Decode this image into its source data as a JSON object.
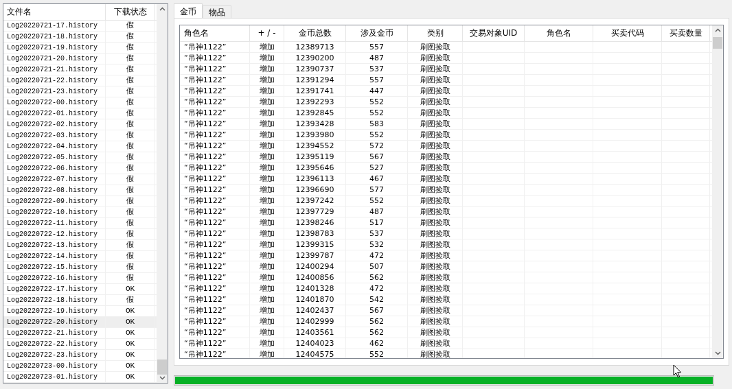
{
  "file_list": {
    "columns": [
      "文件名",
      "下载状态"
    ],
    "items": [
      {
        "name": "Log20220721-17.history",
        "status": "假",
        "selected": false
      },
      {
        "name": "Log20220721-18.history",
        "status": "假",
        "selected": false
      },
      {
        "name": "Log20220721-19.history",
        "status": "假",
        "selected": false
      },
      {
        "name": "Log20220721-20.history",
        "status": "假",
        "selected": false
      },
      {
        "name": "Log20220721-21.history",
        "status": "假",
        "selected": false
      },
      {
        "name": "Log20220721-22.history",
        "status": "假",
        "selected": false
      },
      {
        "name": "Log20220721-23.history",
        "status": "假",
        "selected": false
      },
      {
        "name": "Log20220722-00.history",
        "status": "假",
        "selected": false
      },
      {
        "name": "Log20220722-01.history",
        "status": "假",
        "selected": false
      },
      {
        "name": "Log20220722-02.history",
        "status": "假",
        "selected": false
      },
      {
        "name": "Log20220722-03.history",
        "status": "假",
        "selected": false
      },
      {
        "name": "Log20220722-04.history",
        "status": "假",
        "selected": false
      },
      {
        "name": "Log20220722-05.history",
        "status": "假",
        "selected": false
      },
      {
        "name": "Log20220722-06.history",
        "status": "假",
        "selected": false
      },
      {
        "name": "Log20220722-07.history",
        "status": "假",
        "selected": false
      },
      {
        "name": "Log20220722-08.history",
        "status": "假",
        "selected": false
      },
      {
        "name": "Log20220722-09.history",
        "status": "假",
        "selected": false
      },
      {
        "name": "Log20220722-10.history",
        "status": "假",
        "selected": false
      },
      {
        "name": "Log20220722-11.history",
        "status": "假",
        "selected": false
      },
      {
        "name": "Log20220722-12.history",
        "status": "假",
        "selected": false
      },
      {
        "name": "Log20220722-13.history",
        "status": "假",
        "selected": false
      },
      {
        "name": "Log20220722-14.history",
        "status": "假",
        "selected": false
      },
      {
        "name": "Log20220722-15.history",
        "status": "假",
        "selected": false
      },
      {
        "name": "Log20220722-16.history",
        "status": "假",
        "selected": false
      },
      {
        "name": "Log20220722-17.history",
        "status": "OK",
        "selected": false
      },
      {
        "name": "Log20220722-18.history",
        "status": "假",
        "selected": false
      },
      {
        "name": "Log20220722-19.history",
        "status": "OK",
        "selected": false
      },
      {
        "name": "Log20220722-20.history",
        "status": "OK",
        "selected": true
      },
      {
        "name": "Log20220722-21.history",
        "status": "OK",
        "selected": false
      },
      {
        "name": "Log20220722-22.history",
        "status": "OK",
        "selected": false
      },
      {
        "name": "Log20220722-23.history",
        "status": "OK",
        "selected": false
      },
      {
        "name": "Log20220723-00.history",
        "status": "OK",
        "selected": false
      },
      {
        "name": "Log20220723-01.history",
        "status": "OK",
        "selected": false
      }
    ]
  },
  "tabs": [
    {
      "label": "金币",
      "selected": true
    },
    {
      "label": "物品",
      "selected": false
    }
  ],
  "table": {
    "columns": [
      "角色名",
      "+ / -",
      "金币总数",
      "涉及金币",
      "类别",
      "交易对象UID",
      "角色名",
      "买卖代码",
      "买卖数量"
    ],
    "rows": [
      [
        "“吊神1122”",
        "增加",
        "12389713",
        "557",
        "刷图捡取"
      ],
      [
        "“吊神1122”",
        "增加",
        "12390200",
        "487",
        "刷图捡取"
      ],
      [
        "“吊神1122”",
        "增加",
        "12390737",
        "537",
        "刷图捡取"
      ],
      [
        "“吊神1122”",
        "增加",
        "12391294",
        "557",
        "刷图捡取"
      ],
      [
        "“吊神1122”",
        "增加",
        "12391741",
        "447",
        "刷图捡取"
      ],
      [
        "“吊神1122”",
        "增加",
        "12392293",
        "552",
        "刷图捡取"
      ],
      [
        "“吊神1122”",
        "增加",
        "12392845",
        "552",
        "刷图捡取"
      ],
      [
        "“吊神1122”",
        "增加",
        "12393428",
        "583",
        "刷图捡取"
      ],
      [
        "“吊神1122”",
        "增加",
        "12393980",
        "552",
        "刷图捡取"
      ],
      [
        "“吊神1122”",
        "增加",
        "12394552",
        "572",
        "刷图捡取"
      ],
      [
        "“吊神1122”",
        "增加",
        "12395119",
        "567",
        "刷图捡取"
      ],
      [
        "“吊神1122”",
        "增加",
        "12395646",
        "527",
        "刷图捡取"
      ],
      [
        "“吊神1122”",
        "增加",
        "12396113",
        "467",
        "刷图捡取"
      ],
      [
        "“吊神1122”",
        "增加",
        "12396690",
        "577",
        "刷图捡取"
      ],
      [
        "“吊神1122”",
        "增加",
        "12397242",
        "552",
        "刷图捡取"
      ],
      [
        "“吊神1122”",
        "增加",
        "12397729",
        "487",
        "刷图捡取"
      ],
      [
        "“吊神1122”",
        "增加",
        "12398246",
        "517",
        "刷图捡取"
      ],
      [
        "“吊神1122”",
        "增加",
        "12398783",
        "537",
        "刷图捡取"
      ],
      [
        "“吊神1122”",
        "增加",
        "12399315",
        "532",
        "刷图捡取"
      ],
      [
        "“吊神1122”",
        "增加",
        "12399787",
        "472",
        "刷图捡取"
      ],
      [
        "“吊神1122”",
        "增加",
        "12400294",
        "507",
        "刷图捡取"
      ],
      [
        "“吊神1122”",
        "增加",
        "12400856",
        "562",
        "刷图捡取"
      ],
      [
        "“吊神1122”",
        "增加",
        "12401328",
        "472",
        "刷图捡取"
      ],
      [
        "“吊神1122”",
        "增加",
        "12401870",
        "542",
        "刷图捡取"
      ],
      [
        "“吊神1122”",
        "增加",
        "12402437",
        "567",
        "刷图捡取"
      ],
      [
        "“吊神1122”",
        "增加",
        "12402999",
        "562",
        "刷图捡取"
      ],
      [
        "“吊神1122”",
        "增加",
        "12403561",
        "562",
        "刷图捡取"
      ],
      [
        "“吊神1122”",
        "增加",
        "12404023",
        "462",
        "刷图捡取"
      ],
      [
        "“吊神1122”",
        "增加",
        "12404575",
        "552",
        "刷图捡取"
      ]
    ]
  },
  "progress": {
    "level": 1
  }
}
